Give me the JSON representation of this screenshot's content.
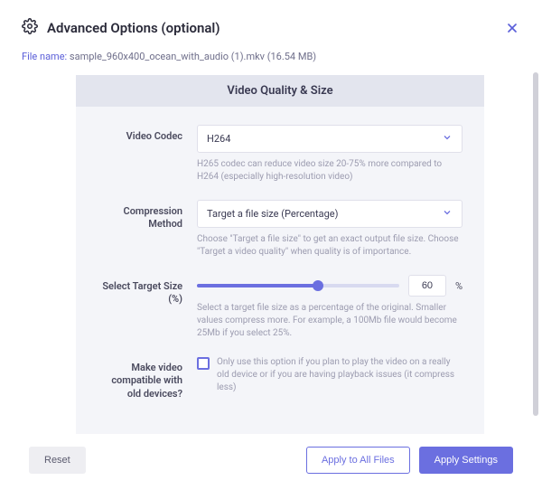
{
  "header": {
    "title": "Advanced Options (optional)"
  },
  "file": {
    "label": "File name: ",
    "name": "sample_960x400_ocean_with_audio (1).mkv (16.54 MB)"
  },
  "panel": {
    "title": "Video Quality & Size",
    "codec": {
      "label": "Video Codec",
      "value": "H264",
      "help": "H265 codec can reduce video size 20-75% more compared to H264 (especially high-resolution video)"
    },
    "compression": {
      "label": "Compression Method",
      "value": "Target a file size (Percentage)",
      "help": "Choose \"Target a file size\" to get an exact output file size. Choose \"Target a video quality\" when quality is of importance."
    },
    "target_size": {
      "label": "Select Target Size (%)",
      "value": "60",
      "percent_symbol": "%",
      "help": "Select a target file size as a percentage of the original. Smaller values compress more. For example, a 100Mb file would become 25Mb if you select 25%."
    },
    "compat": {
      "label": "Make video compatible with old devices?",
      "help": "Only use this option if you plan to play the video on a really old device or if you are having playback issues (it compress less)"
    }
  },
  "footer": {
    "reset": "Reset",
    "apply_all": "Apply to All Files",
    "apply": "Apply Settings"
  }
}
